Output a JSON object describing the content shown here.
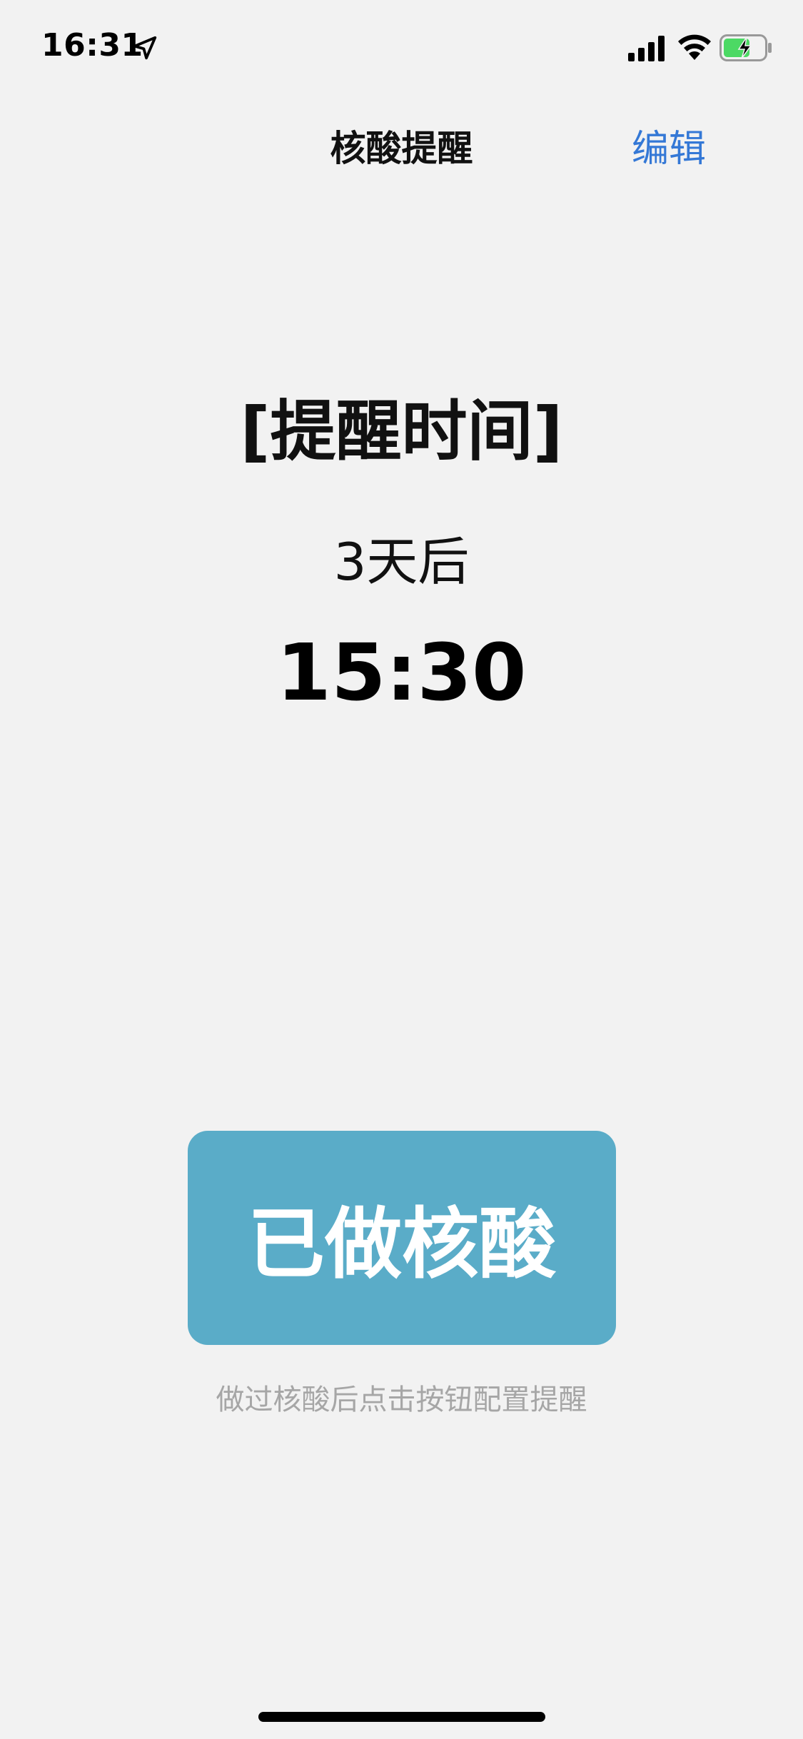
{
  "status_bar": {
    "time": "16:31",
    "icons": [
      "location-arrow-icon",
      "cellular-signal-icon",
      "wifi-icon",
      "battery-charging-icon"
    ],
    "battery_color": "#4cd964"
  },
  "nav": {
    "title": "核酸提醒",
    "edit_label": "编辑",
    "edit_color": "#3478d6"
  },
  "reminder": {
    "heading": "[提醒时间]",
    "days_until": "3天后",
    "time": "15:30"
  },
  "actions": {
    "done_button_label": "已做核酸",
    "done_button_color": "#5aacc8",
    "hint": "做过核酸后点击按钮配置提醒"
  }
}
